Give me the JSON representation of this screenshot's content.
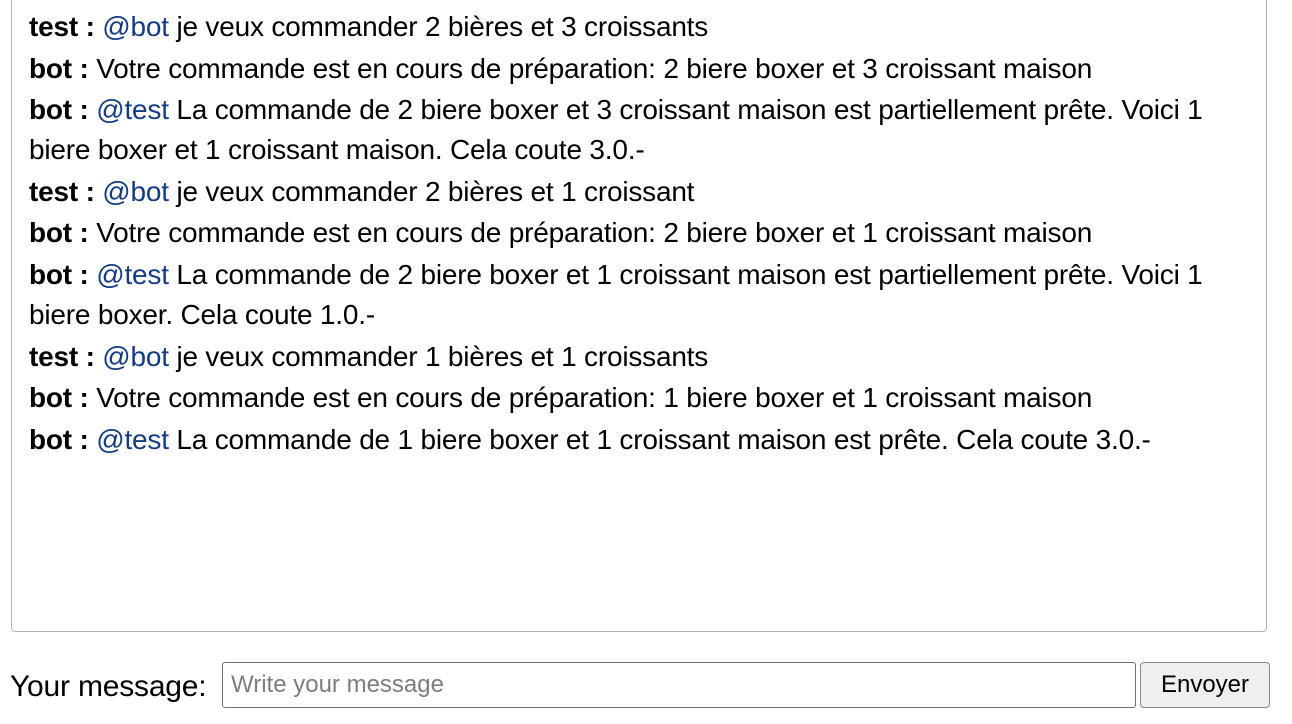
{
  "chat": {
    "messages": [
      {
        "author": "test",
        "separator": " : ",
        "mention": "@bot",
        "text": " je veux commander 2 bières et 3 croissants"
      },
      {
        "author": "bot",
        "separator": " : ",
        "mention": "",
        "text": " Votre commande est en cours de préparation: 2 biere boxer et 3 croissant maison"
      },
      {
        "author": "bot",
        "separator": " : ",
        "mention": "@test",
        "text": " La commande de 2 biere boxer et 3 croissant maison est partiellement prête. Voici 1 biere boxer et 1 croissant maison. Cela coute 3.0.-"
      },
      {
        "author": "test",
        "separator": " : ",
        "mention": "@bot",
        "text": " je veux commander 2 bières et 1 croissant"
      },
      {
        "author": "bot",
        "separator": " : ",
        "mention": "",
        "text": " Votre commande est en cours de préparation: 2 biere boxer et 1 croissant maison"
      },
      {
        "author": "bot",
        "separator": " : ",
        "mention": "@test",
        "text": " La commande de 2 biere boxer et 1 croissant maison est partiellement prête. Voici 1 biere boxer. Cela coute 1.0.-"
      },
      {
        "author": "test",
        "separator": " : ",
        "mention": "@bot",
        "text": " je veux commander 1 bières et 1 croissants"
      },
      {
        "author": "bot",
        "separator": " : ",
        "mention": "",
        "text": " Votre commande est en cours de préparation: 1 biere boxer et 1 croissant maison"
      },
      {
        "author": "bot",
        "separator": " : ",
        "mention": "@test",
        "text": " La commande de 1 biere boxer et 1 croissant maison est prête. Cela coute 3.0.-"
      }
    ]
  },
  "composer": {
    "label": "Your message:",
    "placeholder": "Write your message",
    "value": "",
    "send_label": "Envoyer"
  },
  "colors": {
    "mention": "#143c82",
    "border": "#b4b4b4",
    "button_bg": "#efefef"
  }
}
